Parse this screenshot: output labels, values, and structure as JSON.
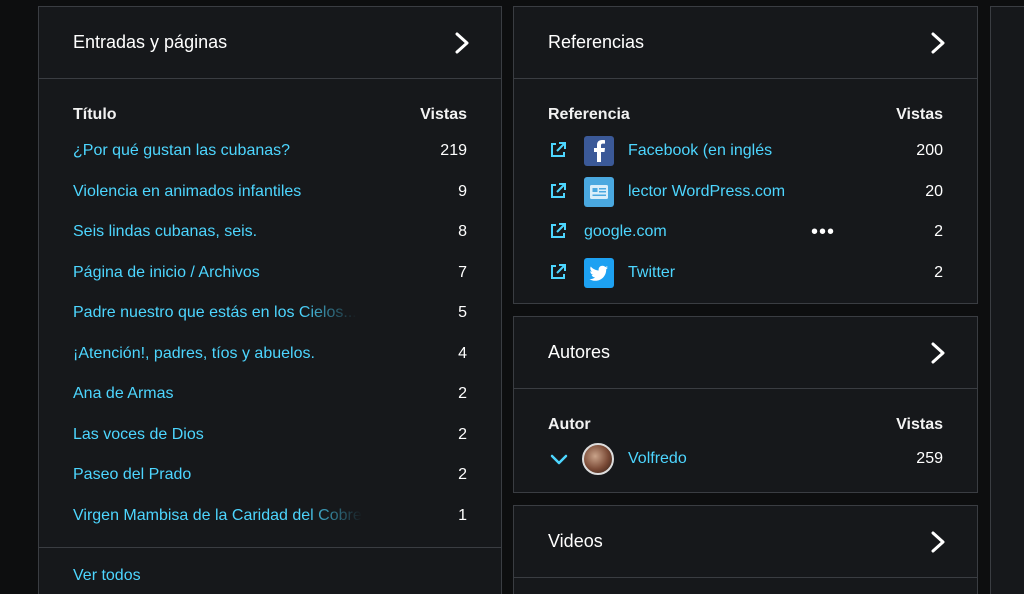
{
  "posts": {
    "title": "Entradas y páginas",
    "col_title": "Título",
    "col_views": "Vistas",
    "rows": [
      {
        "title": "¿Por qué gustan las cubanas?",
        "views": "219"
      },
      {
        "title": "Violencia en animados infantiles",
        "views": "9"
      },
      {
        "title": "Seis lindas cubanas, seis.",
        "views": "8"
      },
      {
        "title": "Página de inicio / Archivos",
        "views": "7"
      },
      {
        "title": "Padre nuestro que estás en los Cielos...",
        "views": "5"
      },
      {
        "title": "¡Atención!, padres, tíos y abuelos.",
        "views": "4"
      },
      {
        "title": "Ana de Armas",
        "views": "2"
      },
      {
        "title": "Las voces de Dios",
        "views": "2"
      },
      {
        "title": "Paseo del Prado",
        "views": "2"
      },
      {
        "title": "Virgen Mambisa de la Caridad del Cobre",
        "views": "1"
      }
    ],
    "view_all": "Ver todos"
  },
  "referrers": {
    "title": "Referencias",
    "col_ref": "Referencia",
    "col_views": "Vistas",
    "rows": [
      {
        "name": "Facebook (en inglés",
        "views": "200",
        "icon": "facebook-icon"
      },
      {
        "name": "lector WordPress.com",
        "views": "20",
        "icon": "wordpress-reader-icon"
      },
      {
        "name": "google.com",
        "views": "2",
        "icon": "none",
        "more": "•••"
      },
      {
        "name": "Twitter",
        "views": "2",
        "icon": "twitter-icon"
      }
    ]
  },
  "authors": {
    "title": "Autores",
    "col_author": "Autor",
    "col_views": "Vistas",
    "rows": [
      {
        "name": "Volfredo",
        "views": "259"
      }
    ]
  },
  "videos": {
    "title": "Videos"
  },
  "colors": {
    "link": "#4dd6ff",
    "panel_bg": "#16181b",
    "border": "#3a3d42",
    "facebook": "#3b5998",
    "twitter": "#1da1f2",
    "reader": "#4aa8e0"
  }
}
